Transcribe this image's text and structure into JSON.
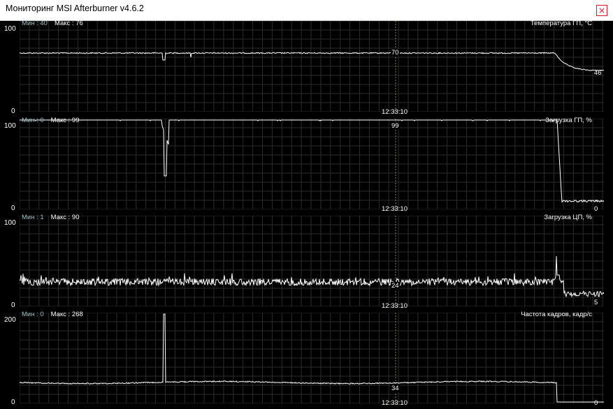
{
  "window": {
    "title": "Мониторинг MSI Afterburner v4.6.2",
    "close_glyph": "×"
  },
  "graphs": [
    {
      "name": "Температура ГП, °C",
      "min_label": "Мин : 40",
      "max_label": "Макс : 76",
      "y_max": "100",
      "y_min": "0",
      "time": "12:33:10",
      "cursor_value": "70",
      "end_value": "46"
    },
    {
      "name": "Загрузка ГП, %",
      "min_label": "Мин : 0",
      "max_label": "Макс : 99",
      "y_max": "100",
      "y_min": "0",
      "time": "12:33:10",
      "cursor_value": "99",
      "end_value": "0"
    },
    {
      "name": "Загрузка ЦП, %",
      "min_label": "Мин : 1",
      "max_label": "Макс : 90",
      "y_max": "100",
      "y_min": "0",
      "time": "12:33:10",
      "cursor_value": "24",
      "end_value": "5"
    },
    {
      "name": "Частота кадров, кадр/с",
      "min_label": "Мин : 0",
      "max_label": "Макс : 268",
      "y_max": "200",
      "y_min": "0",
      "time": "12:33:10",
      "cursor_value": "34",
      "end_value": "0"
    }
  ],
  "colors": {
    "background": "#000000",
    "grid": "#2c2c2c",
    "line": "#ffffff",
    "min_text": "#9bbfc4",
    "cursor": "#8a8a4a"
  }
}
